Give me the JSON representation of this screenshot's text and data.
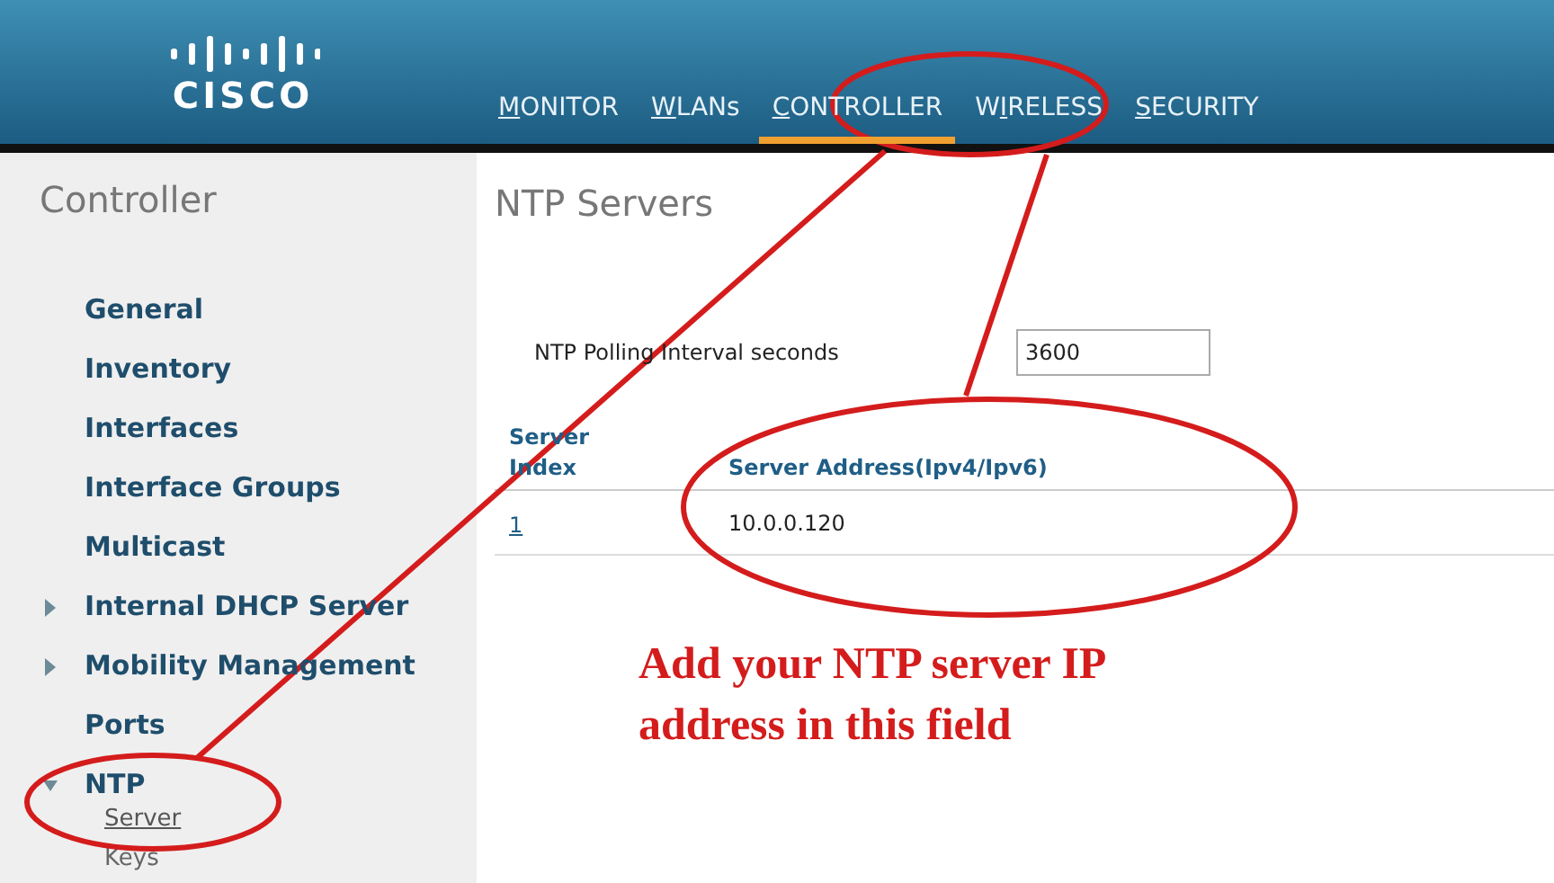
{
  "logo": {
    "wordmark": "CISCO"
  },
  "menu": [
    {
      "key": "M",
      "after": "ONITOR",
      "selected": false
    },
    {
      "key": "W",
      "after": "LANs",
      "selected": false
    },
    {
      "key": "C",
      "after": "ONTROLLER",
      "selected": true
    },
    {
      "before": "W",
      "key": "I",
      "after": "RELESS",
      "selected": false
    },
    {
      "key": "S",
      "after": "ECURITY",
      "selected": false
    }
  ],
  "sidebar": {
    "title": "Controller",
    "items": [
      {
        "label": "General",
        "kind": "link"
      },
      {
        "label": "Inventory",
        "kind": "link"
      },
      {
        "label": "Interfaces",
        "kind": "link"
      },
      {
        "label": "Interface Groups",
        "kind": "link"
      },
      {
        "label": "Multicast",
        "kind": "link"
      },
      {
        "label": "Internal DHCP Server",
        "kind": "group",
        "expanded": false
      },
      {
        "label": "Mobility Management",
        "kind": "group",
        "expanded": false
      },
      {
        "label": "Ports",
        "kind": "link"
      },
      {
        "label": "NTP",
        "kind": "group",
        "expanded": true,
        "children": [
          {
            "label": "Server",
            "selected": true
          },
          {
            "label": "Keys",
            "selected": false
          }
        ]
      }
    ]
  },
  "page": {
    "title": "NTP Servers",
    "polling": {
      "label": "NTP Polling Interval seconds",
      "value": "3600"
    },
    "table": {
      "columns": [
        "Server Index",
        "Server Address(Ipv4/Ipv6)"
      ],
      "rows": [
        [
          "1",
          "10.0.0.120"
        ]
      ]
    }
  },
  "annotation": {
    "text": "Add your NTP server IP address in this field"
  }
}
